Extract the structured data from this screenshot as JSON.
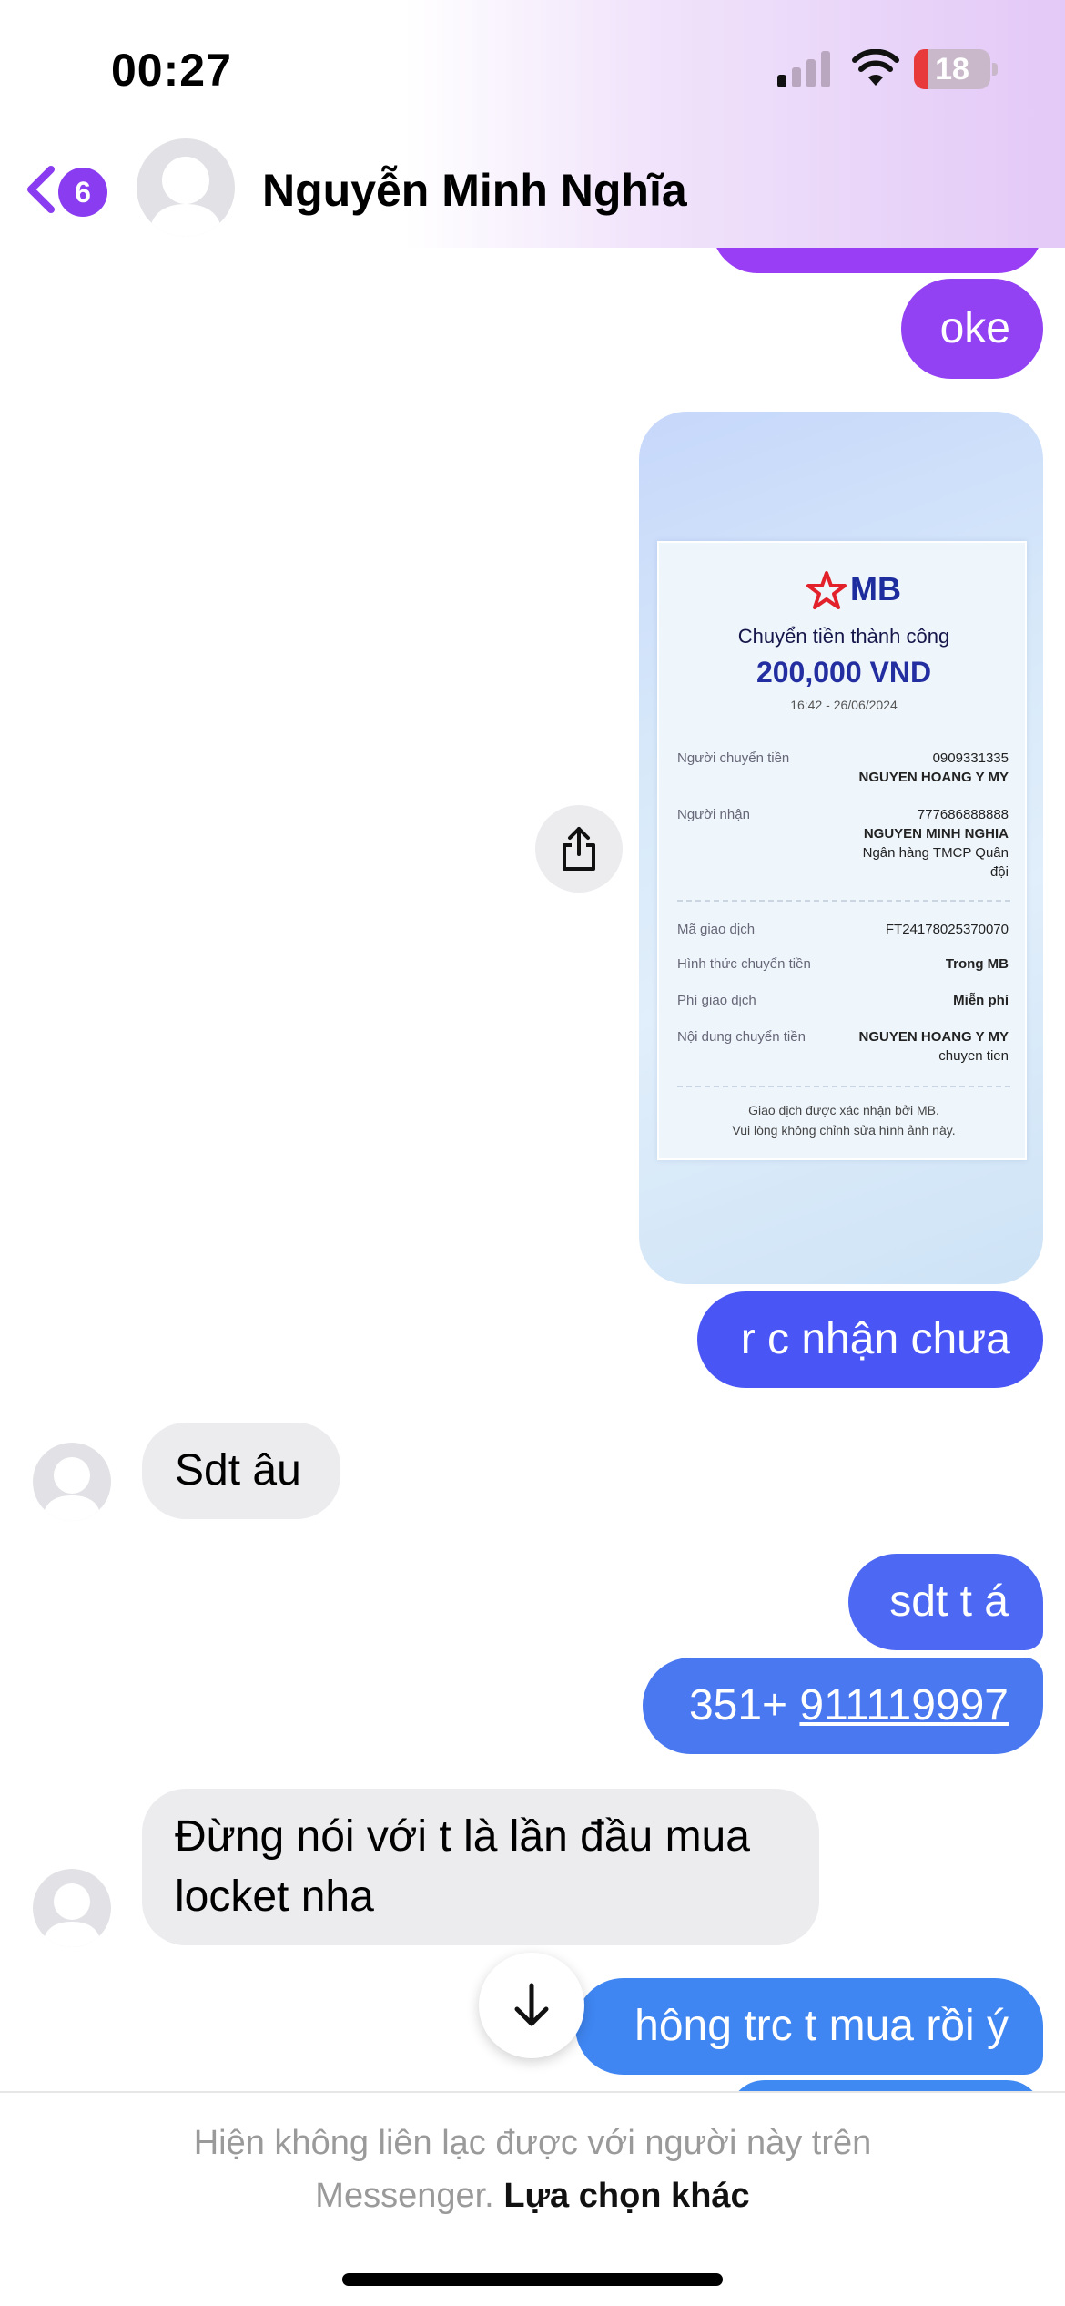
{
  "status_bar": {
    "time": "00:27",
    "battery_level": "18",
    "icons": [
      "signal-icon",
      "wifi-icon",
      "battery-icon"
    ]
  },
  "header": {
    "back_badge": "6",
    "contact_name": "Nguyễn Minh Nghĩa",
    "back_icon": "chevron-left-icon"
  },
  "colors": {
    "accent_purple": "#8a3cf0",
    "bubble_out_purple": "#9241f3",
    "bubble_out_blue": "#4a55f5",
    "bubble_in": "#ececef"
  },
  "messages": [
    {
      "id": "oke",
      "direction": "outgoing",
      "text": "oke"
    },
    {
      "id": "receipt",
      "direction": "outgoing",
      "type": "image",
      "receipt": {
        "bank_logo": "MB",
        "title": "Chuyển tiền thành công",
        "amount": "200,000 VND",
        "datetime": "16:42 - 26/06/2024",
        "sender_label": "Người chuyển tiền",
        "sender_account": "0909331335",
        "sender_name": "NGUYEN HOANG Y MY",
        "receiver_label": "Người nhận",
        "receiver_account": "777686888888",
        "receiver_name": "NGUYEN MINH NGHIA",
        "receiver_bank_line1": "Ngân hàng TMCP Quân",
        "receiver_bank_line2": "đội",
        "txn_id_label": "Mã giao dịch",
        "txn_id": "FT24178025370070",
        "method_label": "Hình thức chuyển tiền",
        "method": "Trong MB",
        "fee_label": "Phí giao dịch",
        "fee": "Miễn phí",
        "content_label": "Nội dung chuyển tiền",
        "content_line1": "NGUYEN HOANG Y MY",
        "content_line2": "chuyen tien",
        "footer_line1": "Giao dịch được xác nhận bởi MB.",
        "footer_line2": "Vui lòng không chỉnh sửa hình ảnh này."
      }
    },
    {
      "id": "nhan",
      "direction": "outgoing",
      "text": "r c nhận chưa"
    },
    {
      "id": "sdt",
      "direction": "incoming",
      "text": "Sdt âu"
    },
    {
      "id": "sdtta",
      "direction": "outgoing",
      "text": "sdt t á"
    },
    {
      "id": "phone",
      "direction": "outgoing",
      "prefix": "351+ ",
      "link": "911119997"
    },
    {
      "id": "dung",
      "direction": "incoming",
      "text": "Đừng nói với t là lần đầu mua locket nha"
    },
    {
      "id": "hong",
      "direction": "outgoing",
      "text": "hông trc t mua rồi ý"
    }
  ],
  "footer": {
    "notice": "Hiện không liên lạc được với người này trên Messenger.",
    "notice_line1": "Hiện không liên lạc được với người này trên",
    "notice_line2": "Messenger.",
    "link": "Lựa chọn khác"
  }
}
